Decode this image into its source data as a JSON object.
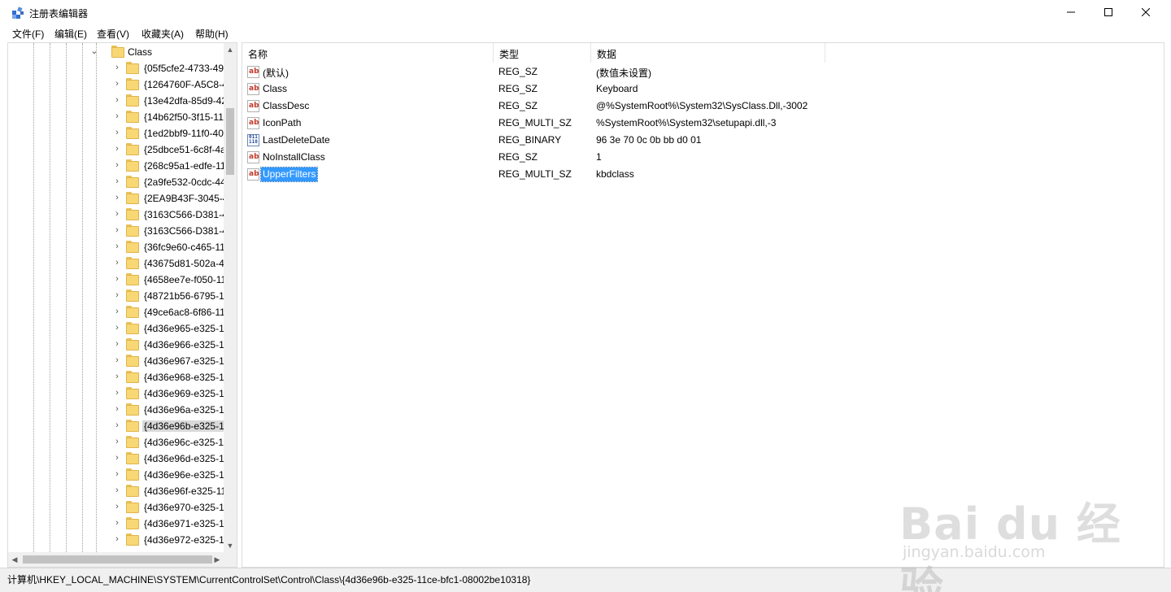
{
  "window": {
    "title": "注册表编辑器",
    "icon": "registry-editor-icon",
    "controls": {
      "minimize": "—",
      "maximize": "☐",
      "close": "✕"
    }
  },
  "menu": [
    "文件(F)",
    "编辑(E)",
    "查看(V)",
    "收藏夹(A)",
    "帮助(H)"
  ],
  "tree": {
    "parent": {
      "label": "Class",
      "expanded": true
    },
    "items": [
      "{05f5cfe2-4733-495",
      "{1264760F-A5C8-4",
      "{13e42dfa-85d9-42",
      "{14b62f50-3f15-11",
      "{1ed2bbf9-11f0-40",
      "{25dbce51-6c8f-4a",
      "{268c95a1-edfe-11",
      "{2a9fe532-0cdc-44",
      "{2EA9B43F-3045-4",
      "{3163C566-D381-4",
      "{3163C566-D381-4",
      "{36fc9e60-c465-11",
      "{43675d81-502a-4",
      "{4658ee7e-f050-11",
      "{48721b56-6795-1",
      "{49ce6ac8-6f86-11",
      "{4d36e965-e325-1",
      "{4d36e966-e325-1",
      "{4d36e967-e325-1",
      "{4d36e968-e325-1",
      "{4d36e969-e325-1",
      "{4d36e96a-e325-1",
      "{4d36e96b-e325-1",
      "{4d36e96c-e325-1",
      "{4d36e96d-e325-1",
      "{4d36e96e-e325-1",
      "{4d36e96f-e325-11",
      "{4d36e970-e325-1",
      "{4d36e971-e325-1",
      "{4d36e972-e325-1"
    ],
    "selected_index": 22
  },
  "columns": {
    "name": "名称",
    "type": "类型",
    "data": "数据"
  },
  "values": [
    {
      "name": "(默认)",
      "type": "REG_SZ",
      "data": "(数值未设置)",
      "icon": "string-value-icon"
    },
    {
      "name": "Class",
      "type": "REG_SZ",
      "data": "Keyboard",
      "icon": "string-value-icon"
    },
    {
      "name": "ClassDesc",
      "type": "REG_SZ",
      "data": "@%SystemRoot%\\System32\\SysClass.Dll,-3002",
      "icon": "string-value-icon"
    },
    {
      "name": "IconPath",
      "type": "REG_MULTI_SZ",
      "data": "%SystemRoot%\\System32\\setupapi.dll,-3",
      "icon": "string-value-icon"
    },
    {
      "name": "LastDeleteDate",
      "type": "REG_BINARY",
      "data": "96 3e 70 0c 0b bb d0 01",
      "icon": "binary-value-icon"
    },
    {
      "name": "NoInstallClass",
      "type": "REG_SZ",
      "data": "1",
      "icon": "string-value-icon"
    },
    {
      "name": "UpperFilters",
      "type": "REG_MULTI_SZ",
      "data": "kbdclass",
      "icon": "string-value-icon"
    }
  ],
  "selected_value_index": 6,
  "status_path": "计算机\\HKEY_LOCAL_MACHINE\\SYSTEM\\CurrentControlSet\\Control\\Class\\{4d36e96b-e325-11ce-bfc1-08002be10318}",
  "watermark": {
    "brand": "Bai du 经验",
    "url": "jingyan.baidu.com"
  }
}
